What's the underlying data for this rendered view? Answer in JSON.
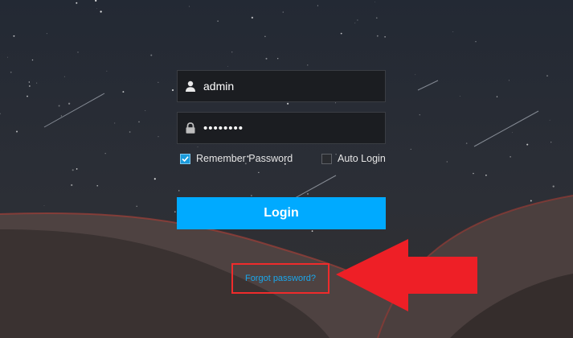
{
  "login_form": {
    "username_value": "admin",
    "password_value": "••••••••",
    "remember_password_label": "Remember Password",
    "remember_password_checked": true,
    "auto_login_label": "Auto Login",
    "auto_login_checked": false,
    "login_button_label": "Login",
    "forgot_password_label": "Forgot password?"
  },
  "icons": {
    "username": "user-icon",
    "password": "lock-icon",
    "annotation": "arrow-left-icon"
  },
  "colors": {
    "accent": "#00aaff",
    "link": "#1aa7ec",
    "annotation": "#ef2b2b",
    "field_background": "#1b1d21",
    "sky": "#1f2530"
  }
}
